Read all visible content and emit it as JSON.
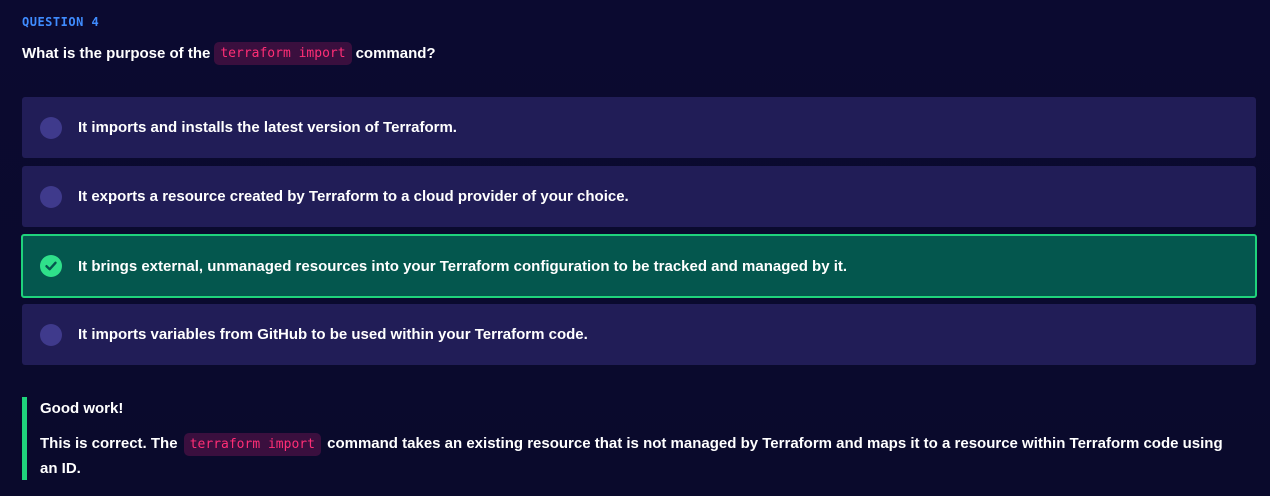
{
  "question": {
    "label": "QUESTION 4",
    "text_before": "What is the purpose of the",
    "code": "terraform import",
    "text_after": "command?"
  },
  "options": [
    {
      "label": "It imports and installs the latest version of Terraform.",
      "state": "unselected"
    },
    {
      "label": "It exports a resource created by Terraform to a cloud provider of your choice.",
      "state": "unselected"
    },
    {
      "label": "It brings external, unmanaged resources into your Terraform configuration to be tracked and managed by it.",
      "state": "correct"
    },
    {
      "label": "It imports variables from GitHub to be used within your Terraform code.",
      "state": "unselected"
    }
  ],
  "feedback": {
    "title": "Good work!",
    "text_before": "This is correct. The",
    "code": "terraform import",
    "text_after": "command takes an existing resource that is not managed by Terraform and maps it to a resource within Terraform code using an ID."
  },
  "icons": {
    "radio": "radio-circle-icon",
    "correct": "check-circle-icon"
  },
  "colors": {
    "background": "#0b0a2e",
    "option_bg": "#211d57",
    "correct_bg": "#04574e",
    "correct_border": "#1fd37c",
    "code_text": "#ff2e76",
    "question_label": "#3f8cff"
  }
}
